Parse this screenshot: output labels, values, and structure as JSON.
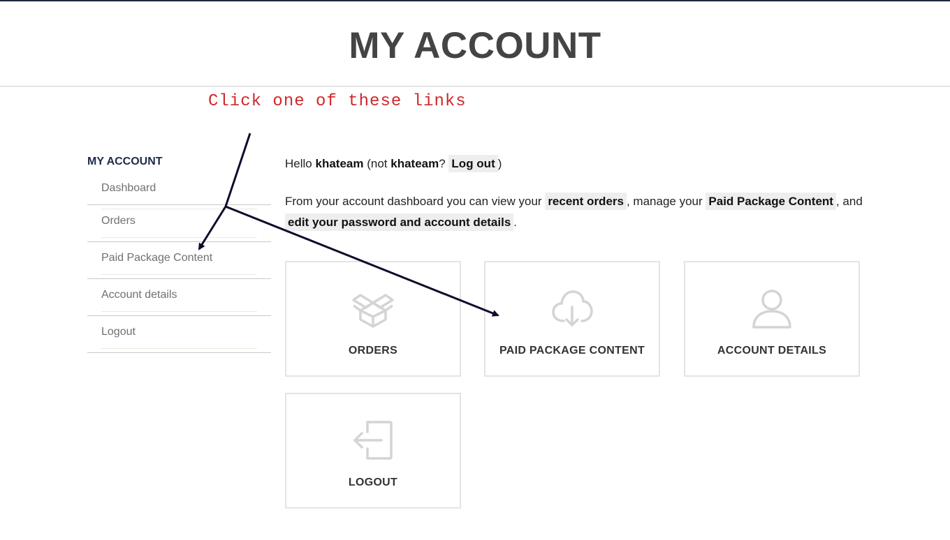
{
  "header": {
    "title": "MY ACCOUNT"
  },
  "annotation": {
    "text": "Click one of these links",
    "color": "#d0282a"
  },
  "sidebar": {
    "title": "MY ACCOUNT",
    "items": [
      {
        "label": "Dashboard"
      },
      {
        "label": "Orders"
      },
      {
        "label": "Paid Package Content"
      },
      {
        "label": "Account details"
      },
      {
        "label": "Logout"
      }
    ]
  },
  "greeting": {
    "hello": "Hello",
    "username": "khateam",
    "not_prefix": "(not",
    "username_repeat": "khateam",
    "question": "?",
    "logout_link": "Log out",
    "close_paren": ")"
  },
  "intro": {
    "part1": "From your account dashboard you can view your",
    "recent_orders_link": "recent orders",
    "part2": ", manage your",
    "paid_package_link": "Paid Package Content",
    "part3": ", and",
    "edit_link": "edit your password and account details",
    "part4": "."
  },
  "tiles": [
    {
      "label": "ORDERS",
      "icon": "box-icon"
    },
    {
      "label": "PAID PACKAGE CONTENT",
      "icon": "cloud-download-icon"
    },
    {
      "label": "ACCOUNT DETAILS",
      "icon": "user-icon"
    },
    {
      "label": "LOGOUT",
      "icon": "logout-icon"
    }
  ],
  "colors": {
    "icon_gray": "#d4d4d4",
    "arrow": "#0d0d2b",
    "heading_navy": "#1e2a4a"
  }
}
